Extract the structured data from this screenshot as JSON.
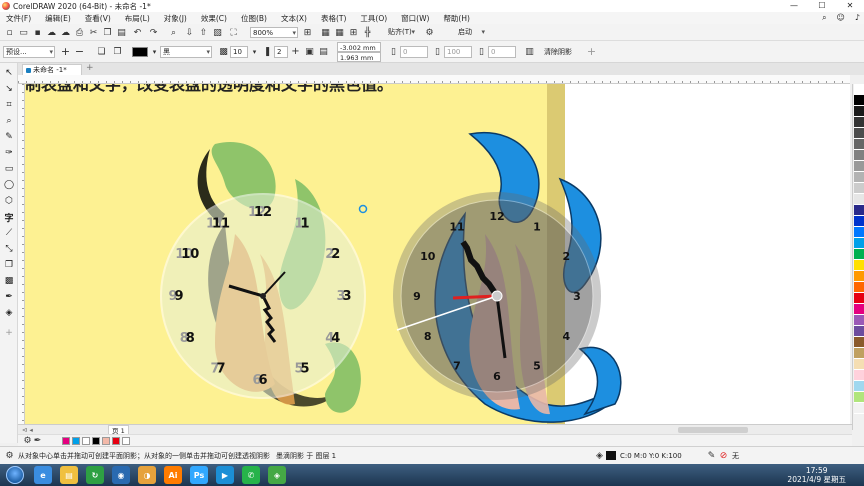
{
  "window": {
    "title": "CorelDRAW 2020 (64-Bit) - 未命名 -1*",
    "controls": [
      "—",
      "☐",
      "✕"
    ]
  },
  "menubar": {
    "items": [
      "文件(F)",
      "编辑(E)",
      "查看(V)",
      "布局(L)",
      "对象(J)",
      "效果(C)",
      "位图(B)",
      "文本(X)",
      "表格(T)",
      "工具(O)",
      "窗口(W)",
      "帮助(H)"
    ]
  },
  "toolbar": {
    "zoom": "800%",
    "snap_label": "贴齐(T)",
    "launch_label": "启动"
  },
  "property_bar": {
    "preset": "预设...",
    "shadow_color_name": "黑",
    "opacity": "10",
    "feather": "2",
    "offset_x": "-3.002 mm",
    "offset_y": "1.963 mm",
    "angle": "0",
    "stretch": "100",
    "fade": "0",
    "clear_shadow_label": "清除阴影"
  },
  "document": {
    "tab_label": "未命名 -1*",
    "page_label": "页 1",
    "caption_text": "制表盘和文字，改变表盘的透明度和文字的黑色值。"
  },
  "clock_left": {
    "numbers": [
      "12",
      "1",
      "2",
      "3",
      "4",
      "5",
      "6",
      "7",
      "8",
      "9",
      "10",
      "11"
    ]
  },
  "clock_right": {
    "numbers": [
      "12",
      "1",
      "2",
      "3",
      "4",
      "5",
      "6",
      "7",
      "8",
      "9",
      "10",
      "11"
    ]
  },
  "status": {
    "hint": "从对象中心单击并拖动可创建平面阴影；从对象的一侧单击并拖动可创建透视阴影",
    "object_info": "墨滴阴影 于 图层 1",
    "color_info": "C:0 M:0 Y:0 K:100",
    "outline_info": "无"
  },
  "taskbar": {
    "time": "17:59",
    "date": "2021/4/9 星期五",
    "apps": [
      "IE",
      "Explorer",
      "Green",
      "Chrome-like",
      "Media",
      "Ai",
      "Ps",
      "Video",
      "Chat",
      "Corel"
    ]
  },
  "colors": {
    "page_yellow": "#fdf192",
    "flame_blue": "#1d8fe0",
    "leaf_green": "#8fc46a",
    "leaf_orange": "#e8a24c",
    "second_hand_red": "#e02020"
  },
  "palette": [
    "#ffffff",
    "#000000",
    "#1a1a1a",
    "#333333",
    "#4d4d4d",
    "#666666",
    "#808080",
    "#999999",
    "#b3b3b3",
    "#cccccc",
    "#e6e6e6",
    "#2a2a8a",
    "#0033cc",
    "#0077ff",
    "#00a0e9",
    "#00b050",
    "#ffe000",
    "#ff9900",
    "#ff6600",
    "#e60012",
    "#e4007f",
    "#9b59b6",
    "#6d4c9e",
    "#8b5a2b",
    "#c0a060",
    "#f5deb3",
    "#ffd1dc",
    "#a0d8ef",
    "#b0e57c",
    "#f2f2f2"
  ],
  "doc_palette": [
    "#e4007f",
    "#00a0e9",
    "#ffffff",
    "#000000",
    "#f2b8a8",
    "#e60012",
    "#ffffff"
  ]
}
